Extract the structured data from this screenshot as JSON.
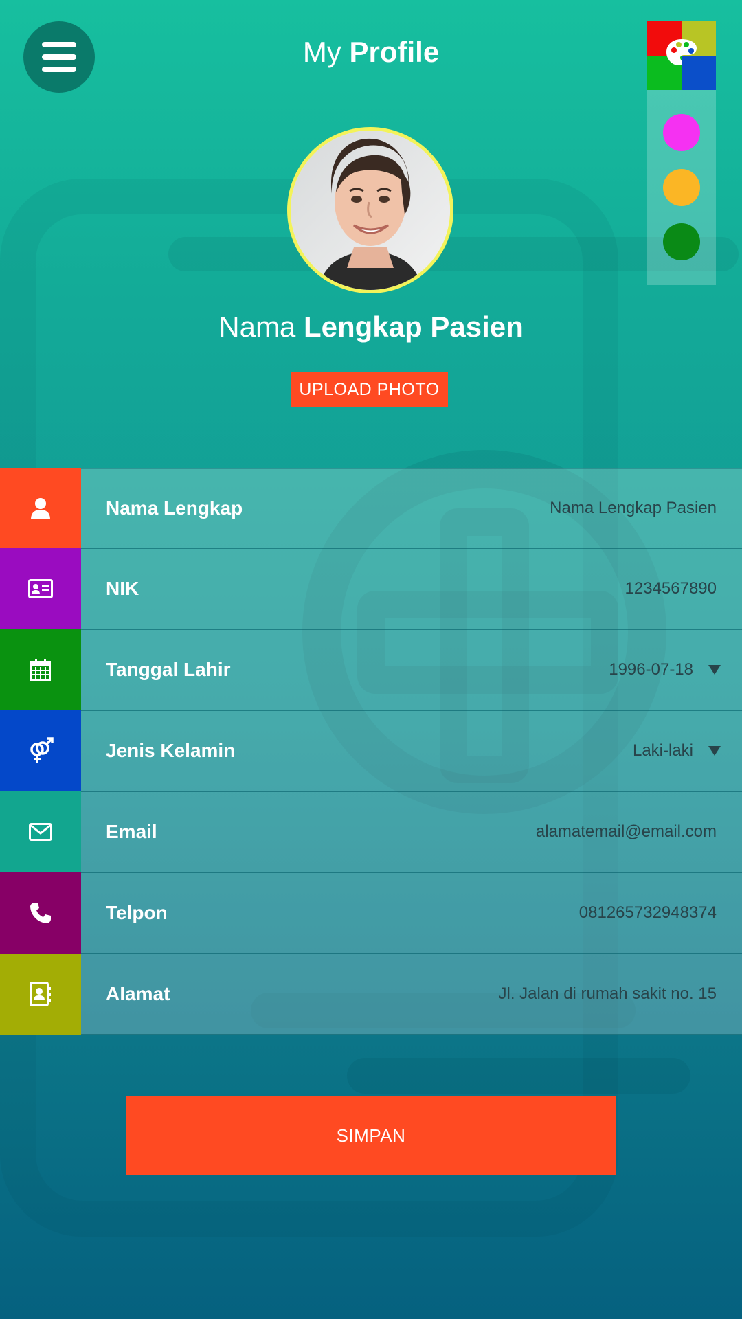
{
  "header": {
    "title_light": "My",
    "title_bold": "Profile"
  },
  "icons": {
    "menu": "hamburger-menu-icon",
    "palette": "palette-icon",
    "name": "user-icon",
    "nik": "id-card-icon",
    "birthdate": "calendar-icon",
    "gender": "gender-icon",
    "email": "envelope-icon",
    "phone": "phone-icon",
    "address": "address-book-icon"
  },
  "theme_swatches": [
    {
      "color": "#f531f2"
    },
    {
      "color": "#fbb625"
    },
    {
      "color": "#0a8a16"
    }
  ],
  "profile": {
    "name_light": "Nama",
    "name_bold": "Lengkap Pasien",
    "upload_label": "UPLOAD PHOTO"
  },
  "form": {
    "fields": [
      {
        "label": "Nama Lengkap",
        "value": "Nama Lengkap Pasien",
        "color": "#ff4a22"
      },
      {
        "label": "NIK",
        "value": "1234567890",
        "color": "#9a0cc0"
      },
      {
        "label": "Tanggal Lahir",
        "value": "1996-07-18",
        "color": "#0a9210"
      },
      {
        "label": "Jenis Kelamin",
        "value": "Laki-laki",
        "color": "#0448c9"
      },
      {
        "label": "Email",
        "value": "alamatemail@email.com",
        "color": "#12a68f"
      },
      {
        "label": "Telpon",
        "value": "081265732948374",
        "color": "#870066"
      },
      {
        "label": "Alamat",
        "value": "Jl. Jalan di rumah sakit no. 15",
        "color": "#a3ad05"
      }
    ]
  },
  "actions": {
    "save_label": "SIMPAN"
  }
}
